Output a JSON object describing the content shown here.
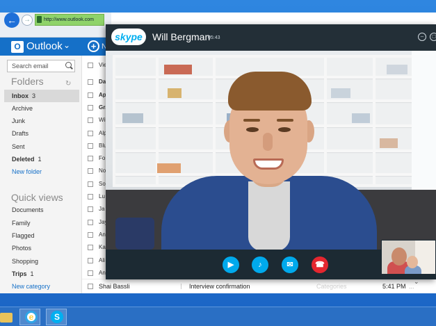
{
  "browser": {
    "url": "http://www.outlook.com",
    "back_icon": "back-arrow-icon",
    "forward_icon": "forward-arrow-icon"
  },
  "outlook": {
    "app_name": "Outlook",
    "logo_letter": "O",
    "new_label": "N",
    "search_placeholder": "Search email",
    "folders_title": "Folders",
    "folders": [
      {
        "label": "Inbox",
        "count": "3"
      },
      {
        "label": "Archive",
        "count": ""
      },
      {
        "label": "Junk",
        "count": ""
      },
      {
        "label": "Drafts",
        "count": ""
      },
      {
        "label": "Sent",
        "count": ""
      },
      {
        "label": "Deleted",
        "count": "1"
      }
    ],
    "new_folder_link": "New folder",
    "quick_views_title": "Quick views",
    "quick_views": [
      {
        "label": "Documents",
        "count": ""
      },
      {
        "label": "Family",
        "count": ""
      },
      {
        "label": "Flagged",
        "count": ""
      },
      {
        "label": "Photos",
        "count": ""
      },
      {
        "label": "Shopping",
        "count": ""
      },
      {
        "label": "Trips",
        "count": "1"
      }
    ],
    "new_category_link": "New category",
    "messages": [
      {
        "sender": "Vie",
        "unread": false
      },
      {
        "sender": "Da",
        "unread": true
      },
      {
        "sender": "Ap",
        "unread": true
      },
      {
        "sender": "Gra",
        "unread": true
      },
      {
        "sender": "Wil",
        "unread": false
      },
      {
        "sender": "Alp",
        "unread": false
      },
      {
        "sender": "Blu",
        "unread": false
      },
      {
        "sender": "Fo",
        "unread": false
      },
      {
        "sender": "No",
        "unread": false
      },
      {
        "sender": "So",
        "unread": false
      },
      {
        "sender": "Lu",
        "unread": false
      },
      {
        "sender": "Ja",
        "unread": false
      },
      {
        "sender": "Jay",
        "unread": false
      },
      {
        "sender": "An",
        "unread": false
      },
      {
        "sender": "Ka",
        "unread": false
      },
      {
        "sender": "Ali",
        "unread": false
      },
      {
        "sender": "An",
        "unread": false
      }
    ],
    "last_message": {
      "sender": "Shai Bassli",
      "subject": "Interview confirmation",
      "category": "Categories",
      "time": "5:41 PM",
      "more": "..."
    }
  },
  "skype": {
    "logo": "skype",
    "caller_name": "Will Bergman",
    "duration": "05:43",
    "controls": [
      {
        "name": "video-button",
        "icon": "video-camera-icon",
        "glyph": "▶",
        "color": "#00a9ec"
      },
      {
        "name": "mute-button",
        "icon": "microphone-icon",
        "glyph": "🎤",
        "color": "#00a9ec"
      },
      {
        "name": "chat-button",
        "icon": "chat-bubble-icon",
        "glyph": "✉",
        "color": "#00a9ec"
      },
      {
        "name": "end-call-button",
        "icon": "hang-up-icon",
        "glyph": "☎",
        "color": "#e4262f"
      }
    ]
  },
  "taskbar": {
    "items": [
      "file-explorer-icon",
      "internet-explorer-icon",
      "skype-icon"
    ],
    "ie_glyph": "e",
    "skype_glyph": "S"
  },
  "colors": {
    "outlook_blue": "#1570c8",
    "skype_blue": "#00aff0",
    "end_call_red": "#e4262f"
  }
}
